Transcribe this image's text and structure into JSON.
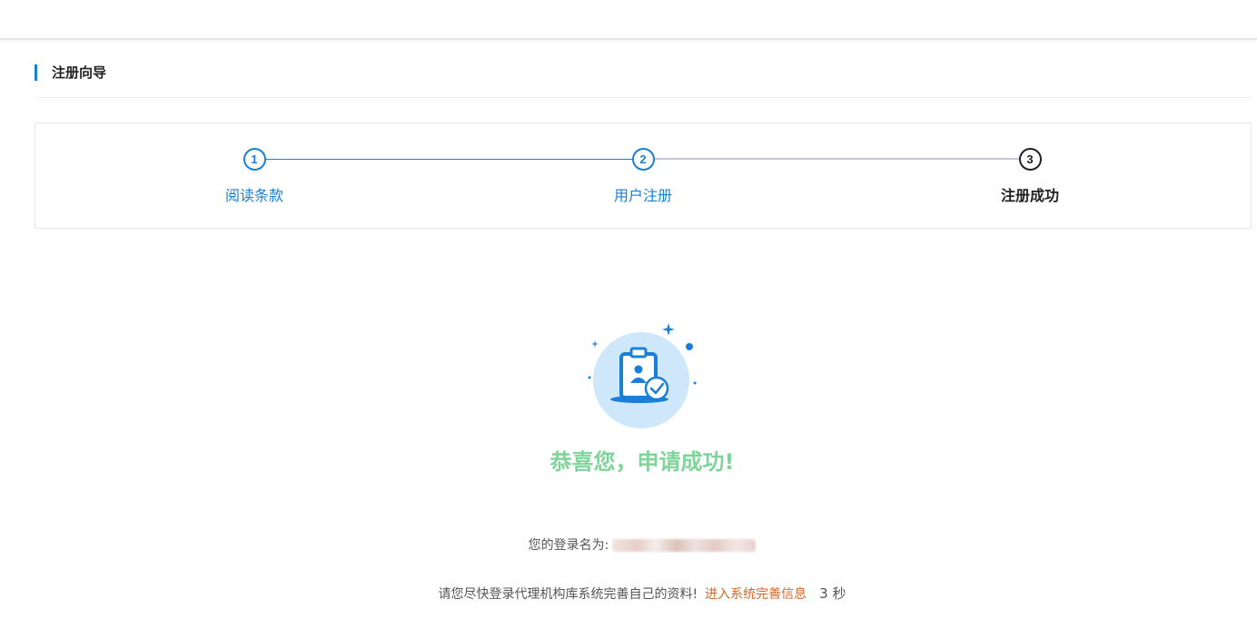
{
  "section": {
    "title": "注册向导"
  },
  "steps": [
    {
      "number": "1",
      "label": "阅读条款"
    },
    {
      "number": "2",
      "label": "用户注册"
    },
    {
      "number": "3",
      "label": "注册成功"
    }
  ],
  "result": {
    "title": "恭喜您，申请成功!",
    "login_label": "您的登录名为:",
    "notice": "请您尽快登录代理机构库系统完善自己的资料!",
    "enter_link": "进入系统完善信息",
    "countdown": "3 秒"
  },
  "colors": {
    "accent": "#1a7fd6",
    "success": "#7fd49a",
    "link": "#d2692a"
  },
  "icons": {
    "success": "clipboard-user-check-icon"
  }
}
